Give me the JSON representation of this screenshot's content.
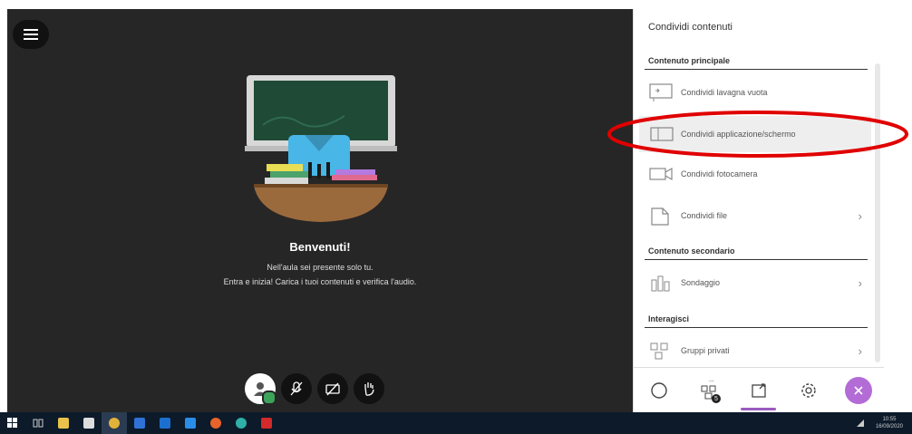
{
  "stage": {
    "welcome_title": "Benvenuti!",
    "welcome_line1": "Nell'aula sei presente solo tu.",
    "welcome_line2": "Entra e inizia! Carica i tuoi contenuti e verifica l'audio."
  },
  "panel": {
    "title": "Condividi contenuti",
    "primary_label": "Contenuto principale",
    "items_primary": [
      {
        "label": "Condividi lavagna vuota",
        "icon": "whiteboard-icon"
      },
      {
        "label": "Condividi applicazione/schermo",
        "icon": "screen-share-icon"
      },
      {
        "label": "Condividi fotocamera",
        "icon": "camera-icon"
      },
      {
        "label": "Condividi file",
        "icon": "file-icon",
        "chevron": "›"
      }
    ],
    "secondary_label": "Contenuto secondario",
    "items_secondary": [
      {
        "label": "Sondaggio",
        "icon": "poll-icon",
        "chevron": "›"
      }
    ],
    "interact_label": "Interagisci",
    "items_interact": [
      {
        "label": "Gruppi privati",
        "icon": "groups-icon",
        "chevron": "›"
      }
    ],
    "tabs": {
      "attendee_count": "...",
      "attendee_badge": "5"
    }
  },
  "taskbar": {
    "clock_time": "10:55",
    "clock_date": "16/09/2020"
  },
  "colors": {
    "accent": "#b36cd6",
    "annotation": "#e00000",
    "stage_bg": "#262626"
  }
}
